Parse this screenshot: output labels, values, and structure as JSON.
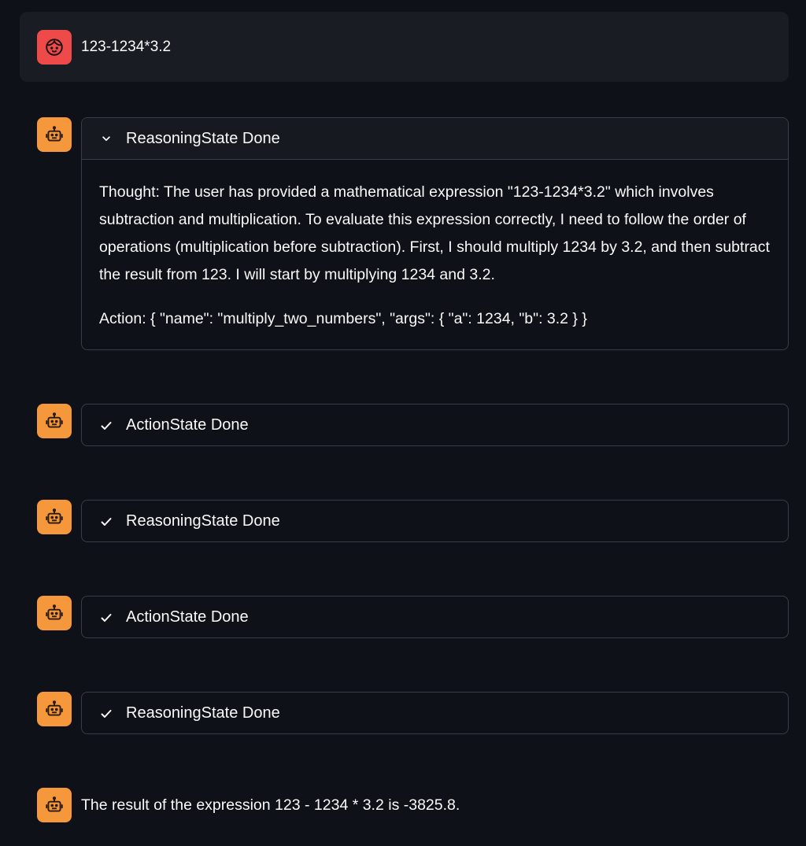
{
  "user_message": {
    "avatar_icon": "user-face-icon",
    "avatar_color": "#ef4a4a",
    "text": "123-1234*3.2"
  },
  "assistant_avatar": {
    "icon": "robot-icon",
    "color": "#f5973b"
  },
  "steps": [
    {
      "label": "ReasoningState Done",
      "expanded": true,
      "icon": "chevron-down-icon",
      "thought": "Thought: The user has provided a mathematical expression \"123-1234*3.2\" which involves subtraction and multiplication. To evaluate this expression correctly, I need to follow the order of operations (multiplication before subtraction). First, I should multiply 1234 by 3.2, and then subtract the result from 123. I will start by multiplying 1234 and 3.2.",
      "action": "Action: { \"name\": \"multiply_two_numbers\", \"args\": { \"a\": 1234, \"b\": 3.2 } }"
    },
    {
      "label": "ActionState Done",
      "expanded": false,
      "icon": "check-icon"
    },
    {
      "label": "ReasoningState Done",
      "expanded": false,
      "icon": "check-icon"
    },
    {
      "label": "ActionState Done",
      "expanded": false,
      "icon": "check-icon"
    },
    {
      "label": "ReasoningState Done",
      "expanded": false,
      "icon": "check-icon"
    }
  ],
  "final_answer": "The result of the expression 123 - 1234 * 3.2 is -3825.8."
}
